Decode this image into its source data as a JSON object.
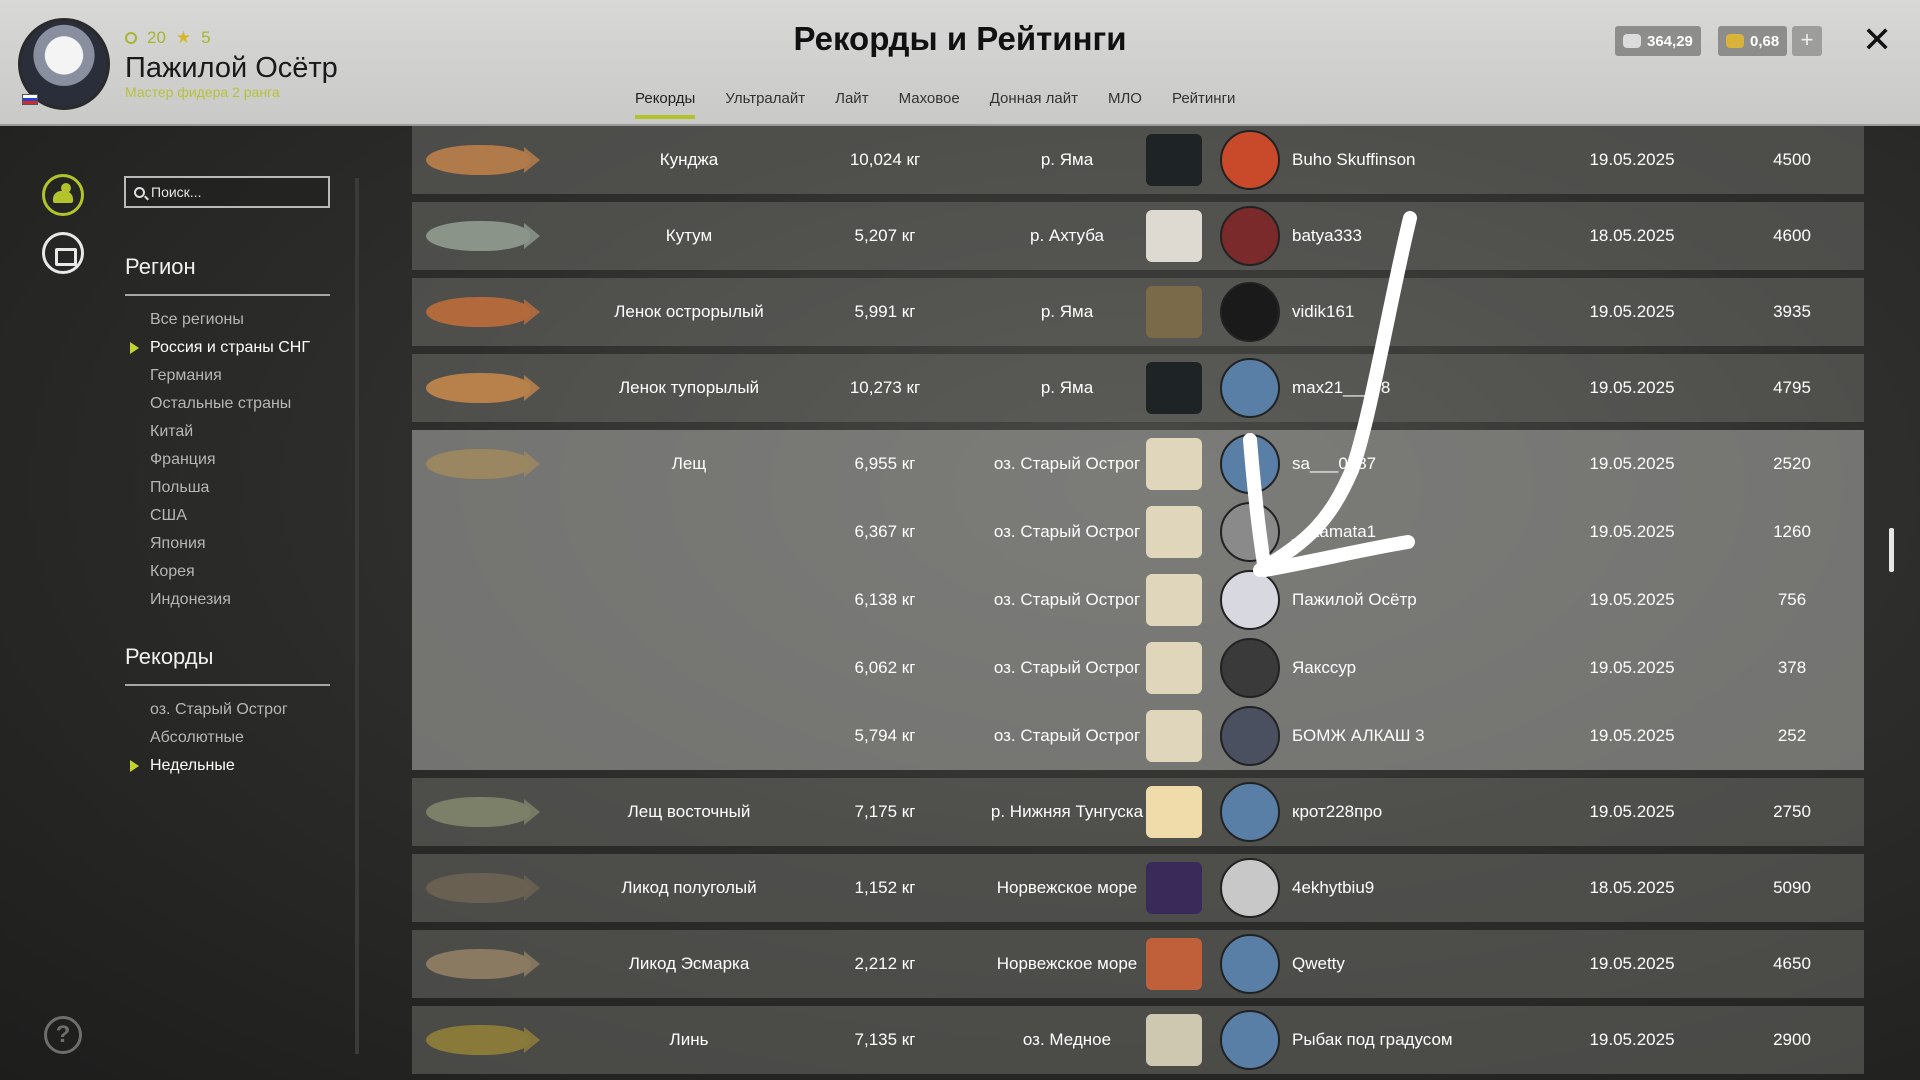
{
  "header": {
    "title": "Рекорды и Рейтинги",
    "player": {
      "name": "Пажилой Осётр",
      "rank": "Мастер фидера 2 ранга",
      "level": "20",
      "stars": "5"
    },
    "tabs": [
      {
        "label": "Рекорды",
        "active": true
      },
      {
        "label": "Ультралайт",
        "active": false
      },
      {
        "label": "Лайт",
        "active": false
      },
      {
        "label": "Маховое",
        "active": false
      },
      {
        "label": "Донная лайт",
        "active": false
      },
      {
        "label": "МЛО",
        "active": false
      },
      {
        "label": "Рейтинги",
        "active": false
      }
    ],
    "currency_silver": "364,29",
    "currency_gold": "0,68",
    "plus_label": "+",
    "close_label": "✕"
  },
  "sidebar": {
    "search_placeholder": "Поиск...",
    "region_title": "Регион",
    "regions": [
      {
        "label": "Все регионы",
        "selected": false
      },
      {
        "label": "Россия и страны СНГ",
        "selected": true
      },
      {
        "label": "Германия",
        "selected": false
      },
      {
        "label": "Остальные страны",
        "selected": false
      },
      {
        "label": "Китай",
        "selected": false
      },
      {
        "label": "Франция",
        "selected": false
      },
      {
        "label": "Польша",
        "selected": false
      },
      {
        "label": "США",
        "selected": false
      },
      {
        "label": "Япония",
        "selected": false
      },
      {
        "label": "Корея",
        "selected": false
      },
      {
        "label": "Индонезия",
        "selected": false
      }
    ],
    "records_title": "Рекорды",
    "records": [
      {
        "label": "оз. Старый Острог",
        "selected": false
      },
      {
        "label": "Абсолютные",
        "selected": false
      },
      {
        "label": "Недельные",
        "selected": true
      }
    ],
    "help_label": "?"
  },
  "table": {
    "rows": [
      {
        "fish": "Кунджа",
        "weight": "10,024 кг",
        "location": "р. Яма",
        "user": "Buho Skuffinson",
        "date": "19.05.2025",
        "score": "4500",
        "fish_color": "#b07a4a",
        "bait_color": "#1e2326",
        "avatar_color": "#c84a2a",
        "expanded": false
      },
      {
        "fish": "Кутум",
        "weight": "5,207 кг",
        "location": "р. Ахтуба",
        "user": "batya333",
        "date": "18.05.2025",
        "score": "4600",
        "fish_color": "#8a9488",
        "bait_color": "#dedad2",
        "avatar_color": "#7a2a2a",
        "expanded": false
      },
      {
        "fish": "Ленок острорылый",
        "weight": "5,991 кг",
        "location": "р. Яма",
        "user": "vidik161",
        "date": "19.05.2025",
        "score": "3935",
        "fish_color": "#b26a3c",
        "bait_color": "#7b6a4a",
        "avatar_color": "#1a1a1a",
        "expanded": false
      },
      {
        "fish": "Ленок тупорылый",
        "weight": "10,273 кг",
        "location": "р. Яма",
        "user": "max21___08",
        "date": "19.05.2025",
        "score": "4795",
        "fish_color": "#b8804a",
        "bait_color": "#1e2326",
        "avatar_color": "#5a7fa6",
        "expanded": false
      }
    ],
    "group": {
      "fish": "Лещ",
      "fish_color": "#9a8660",
      "entries": [
        {
          "weight": "6,955 кг",
          "location": "оз. Старый Острог",
          "user": "sa___0587",
          "date": "19.05.2025",
          "score": "2520",
          "bait_color": "#e0d6bc",
          "avatar_color": "#5a7fa6"
        },
        {
          "weight": "6,367 кг",
          "location": "оз. Старый Острог",
          "user": "__kamata1",
          "date": "19.05.2025",
          "score": "1260",
          "bait_color": "#e0d6bc",
          "avatar_color": "#8a8a8a"
        },
        {
          "weight": "6,138 кг",
          "location": "оз. Старый Острог",
          "user": "Пажилой Осётр",
          "date": "19.05.2025",
          "score": "756",
          "bait_color": "#e0d6bc",
          "avatar_color": "#d8d8e0"
        },
        {
          "weight": "6,062 кг",
          "location": "оз. Старый Острог",
          "user": "Яакссур",
          "date": "19.05.2025",
          "score": "378",
          "bait_color": "#e0d6bc",
          "avatar_color": "#3a3a3a"
        },
        {
          "weight": "5,794 кг",
          "location": "оз. Старый Острог",
          "user": "БОМЖ АЛКАШ 3",
          "date": "19.05.2025",
          "score": "252",
          "bait_color": "#e0d6bc",
          "avatar_color": "#4a5060"
        }
      ]
    },
    "rows_after": [
      {
        "fish": "Лещ восточный",
        "weight": "7,175 кг",
        "location": "р. Нижняя Тунгуска",
        "user": "крот228про",
        "date": "19.05.2025",
        "score": "2750",
        "fish_color": "#7c8068",
        "bait_color": "#f0dcaa",
        "avatar_color": "#5a7fa6"
      },
      {
        "fish": "Ликод полуголый",
        "weight": "1,152 кг",
        "location": "Норвежское море",
        "user": "4ekhytbiu9",
        "date": "18.05.2025",
        "score": "5090",
        "fish_color": "#6a6052",
        "bait_color": "#3a2a5a",
        "avatar_color": "#c8c8c8"
      },
      {
        "fish": "Ликод Эсмарка",
        "weight": "2,212 кг",
        "location": "Норвежское море",
        "user": "Qwetty",
        "date": "19.05.2025",
        "score": "4650",
        "fish_color": "#8a7a62",
        "bait_color": "#c0603a",
        "avatar_color": "#5a7fa6"
      },
      {
        "fish": "Линь",
        "weight": "7,135 кг",
        "location": "оз. Медное",
        "user": "Рыбак под градусом",
        "date": "19.05.2025",
        "score": "2900",
        "fish_color": "#8a7a3a",
        "bait_color": "#cfc8b0",
        "avatar_color": "#5a7fa6"
      }
    ]
  }
}
